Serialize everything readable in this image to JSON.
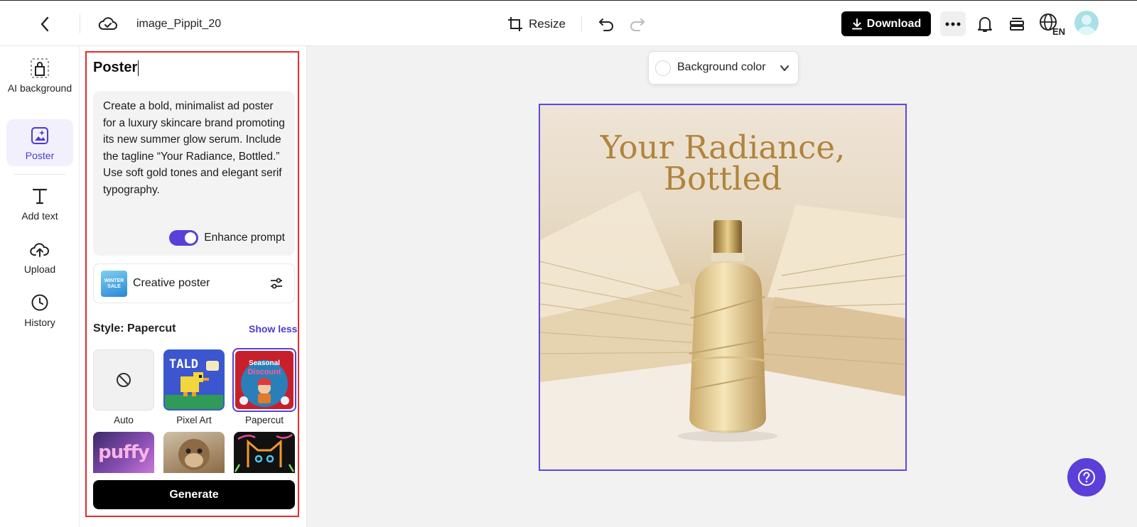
{
  "header": {
    "file_name": "image_Pippit_20",
    "resize_label": "Resize",
    "download_label": "Download",
    "language_badge": "EN"
  },
  "rail": {
    "items": [
      {
        "label": "AI background",
        "icon": "ai-background-icon"
      },
      {
        "label": "Poster",
        "icon": "poster-icon",
        "active": true
      },
      {
        "label": "Add text",
        "icon": "text-icon"
      },
      {
        "label": "Upload",
        "icon": "upload-icon"
      },
      {
        "label": "History",
        "icon": "history-icon"
      }
    ]
  },
  "panel": {
    "title": "Poster",
    "prompt": "Create a bold, minimalist ad poster for a luxury skincare brand promoting its new summer glow serum. Include the tagline “Your Radiance, Bottled.” Use soft gold tones and elegant serif typography.",
    "enhance_label": "Enhance prompt",
    "enhance_on": true,
    "creative_label": "Creative poster",
    "creative_thumb_text": [
      "WINTER",
      "SALE"
    ],
    "style_label": "Style: Papercut",
    "show_less": "Show less",
    "styles": [
      {
        "label": "Auto"
      },
      {
        "label": "Pixel Art",
        "thumb_text": "TALD"
      },
      {
        "label": "Papercut",
        "selected": true,
        "thumb_text": [
          "Seasonal",
          "Discount"
        ]
      },
      {
        "thumb_text": "puffy"
      },
      {},
      {}
    ],
    "generate_label": "Generate"
  },
  "canvas": {
    "bg_color_label": "Background color",
    "poster_headline": [
      "Your Radiance,",
      "Bottled"
    ]
  },
  "colors": {
    "accent": "#5b3fd9",
    "highlight_outline": "#e32b2b",
    "headline_gold": "#b0843b"
  }
}
